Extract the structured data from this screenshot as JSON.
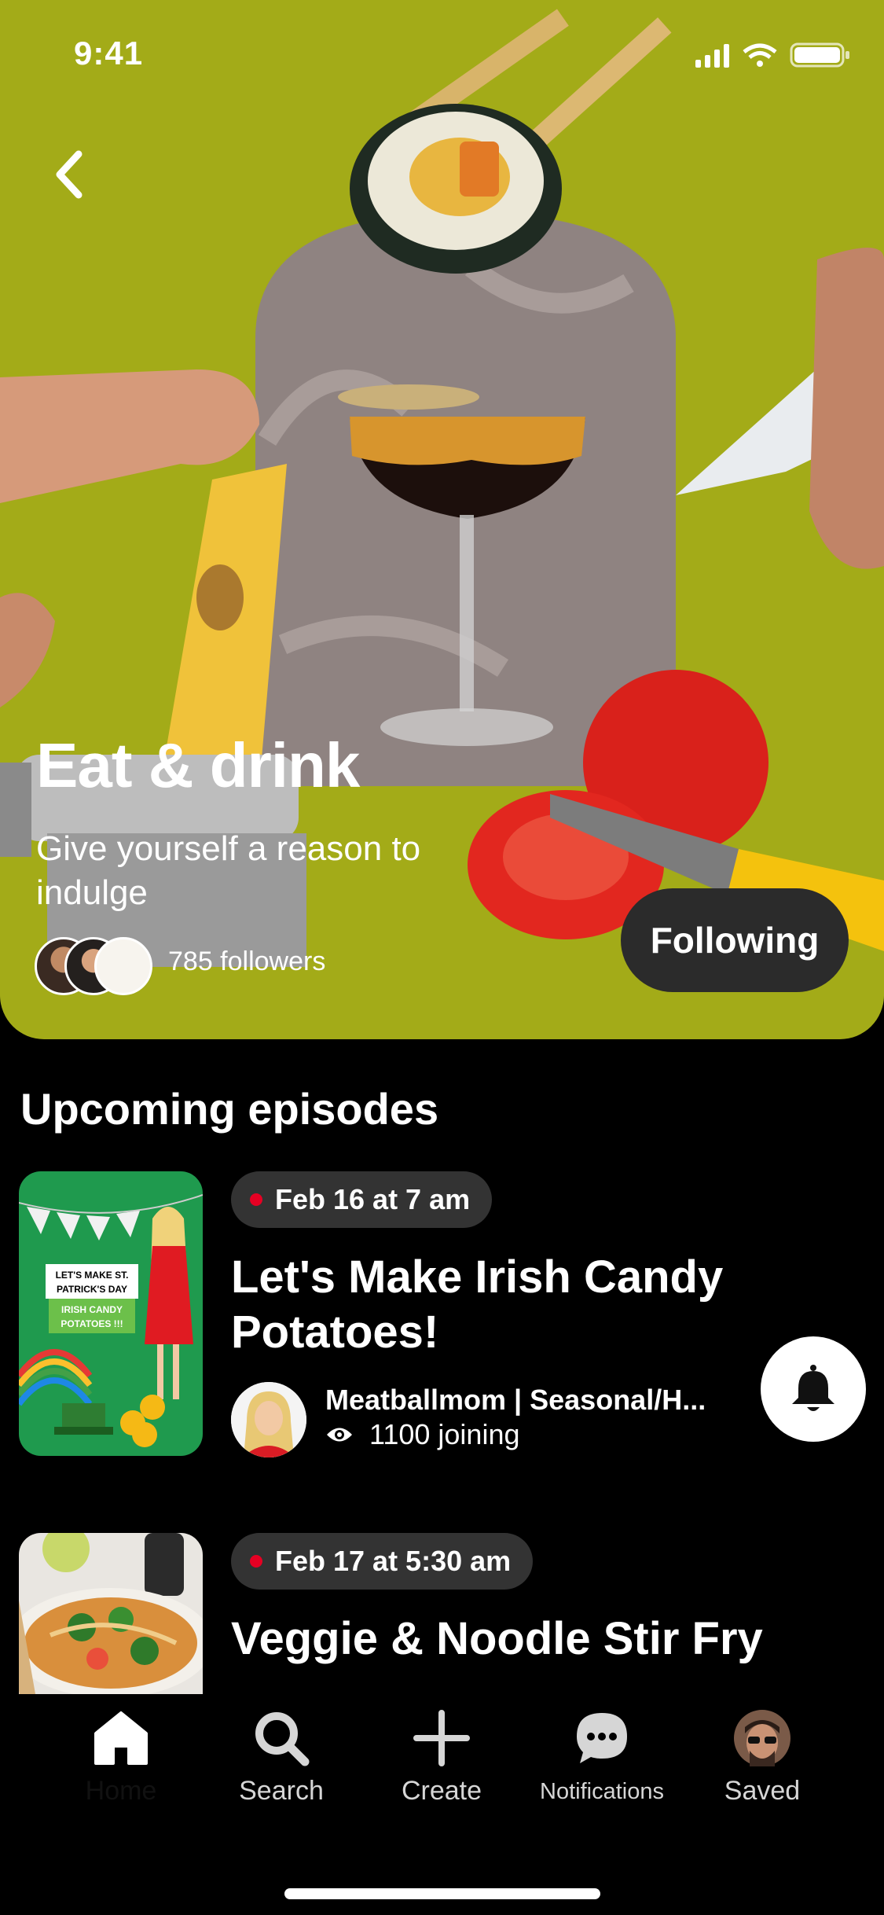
{
  "status_bar": {
    "time": "9:41"
  },
  "hero": {
    "title": "Eat & drink",
    "subtitle": "Give yourself a reason to indulge",
    "followers": "785 followers",
    "follow_button": "Following",
    "bg_color": "#a3ab18"
  },
  "section": {
    "title": "Upcoming episodes"
  },
  "episodes": [
    {
      "date": "Feb 16 at 7 am",
      "title": "Let's Make Irish Candy Potatoes!",
      "host": "Meatballmom |  Seasonal/H...",
      "joining": "1100 joining",
      "thumb_text": [
        "LET'S MAKE ST. PATRICK'S DAY",
        "IRISH CANDY POTATOES !!!"
      ]
    },
    {
      "date": "Feb 17 at 5:30 am",
      "title": "Veggie & Noodle Stir Fry",
      "thumb_text": []
    }
  ],
  "tabs": [
    {
      "label": "Home",
      "icon": "home-icon",
      "active": true
    },
    {
      "label": "Search",
      "icon": "search-icon"
    },
    {
      "label": "Create",
      "icon": "plus-icon"
    },
    {
      "label": "Notifications",
      "icon": "chat-bubble-icon"
    },
    {
      "label": "Saved",
      "icon": "profile-avatar"
    }
  ],
  "colors": {
    "live_dot": "#e60023",
    "pill_bg": "#333333",
    "follow_btn_bg": "#2b2b2b"
  }
}
